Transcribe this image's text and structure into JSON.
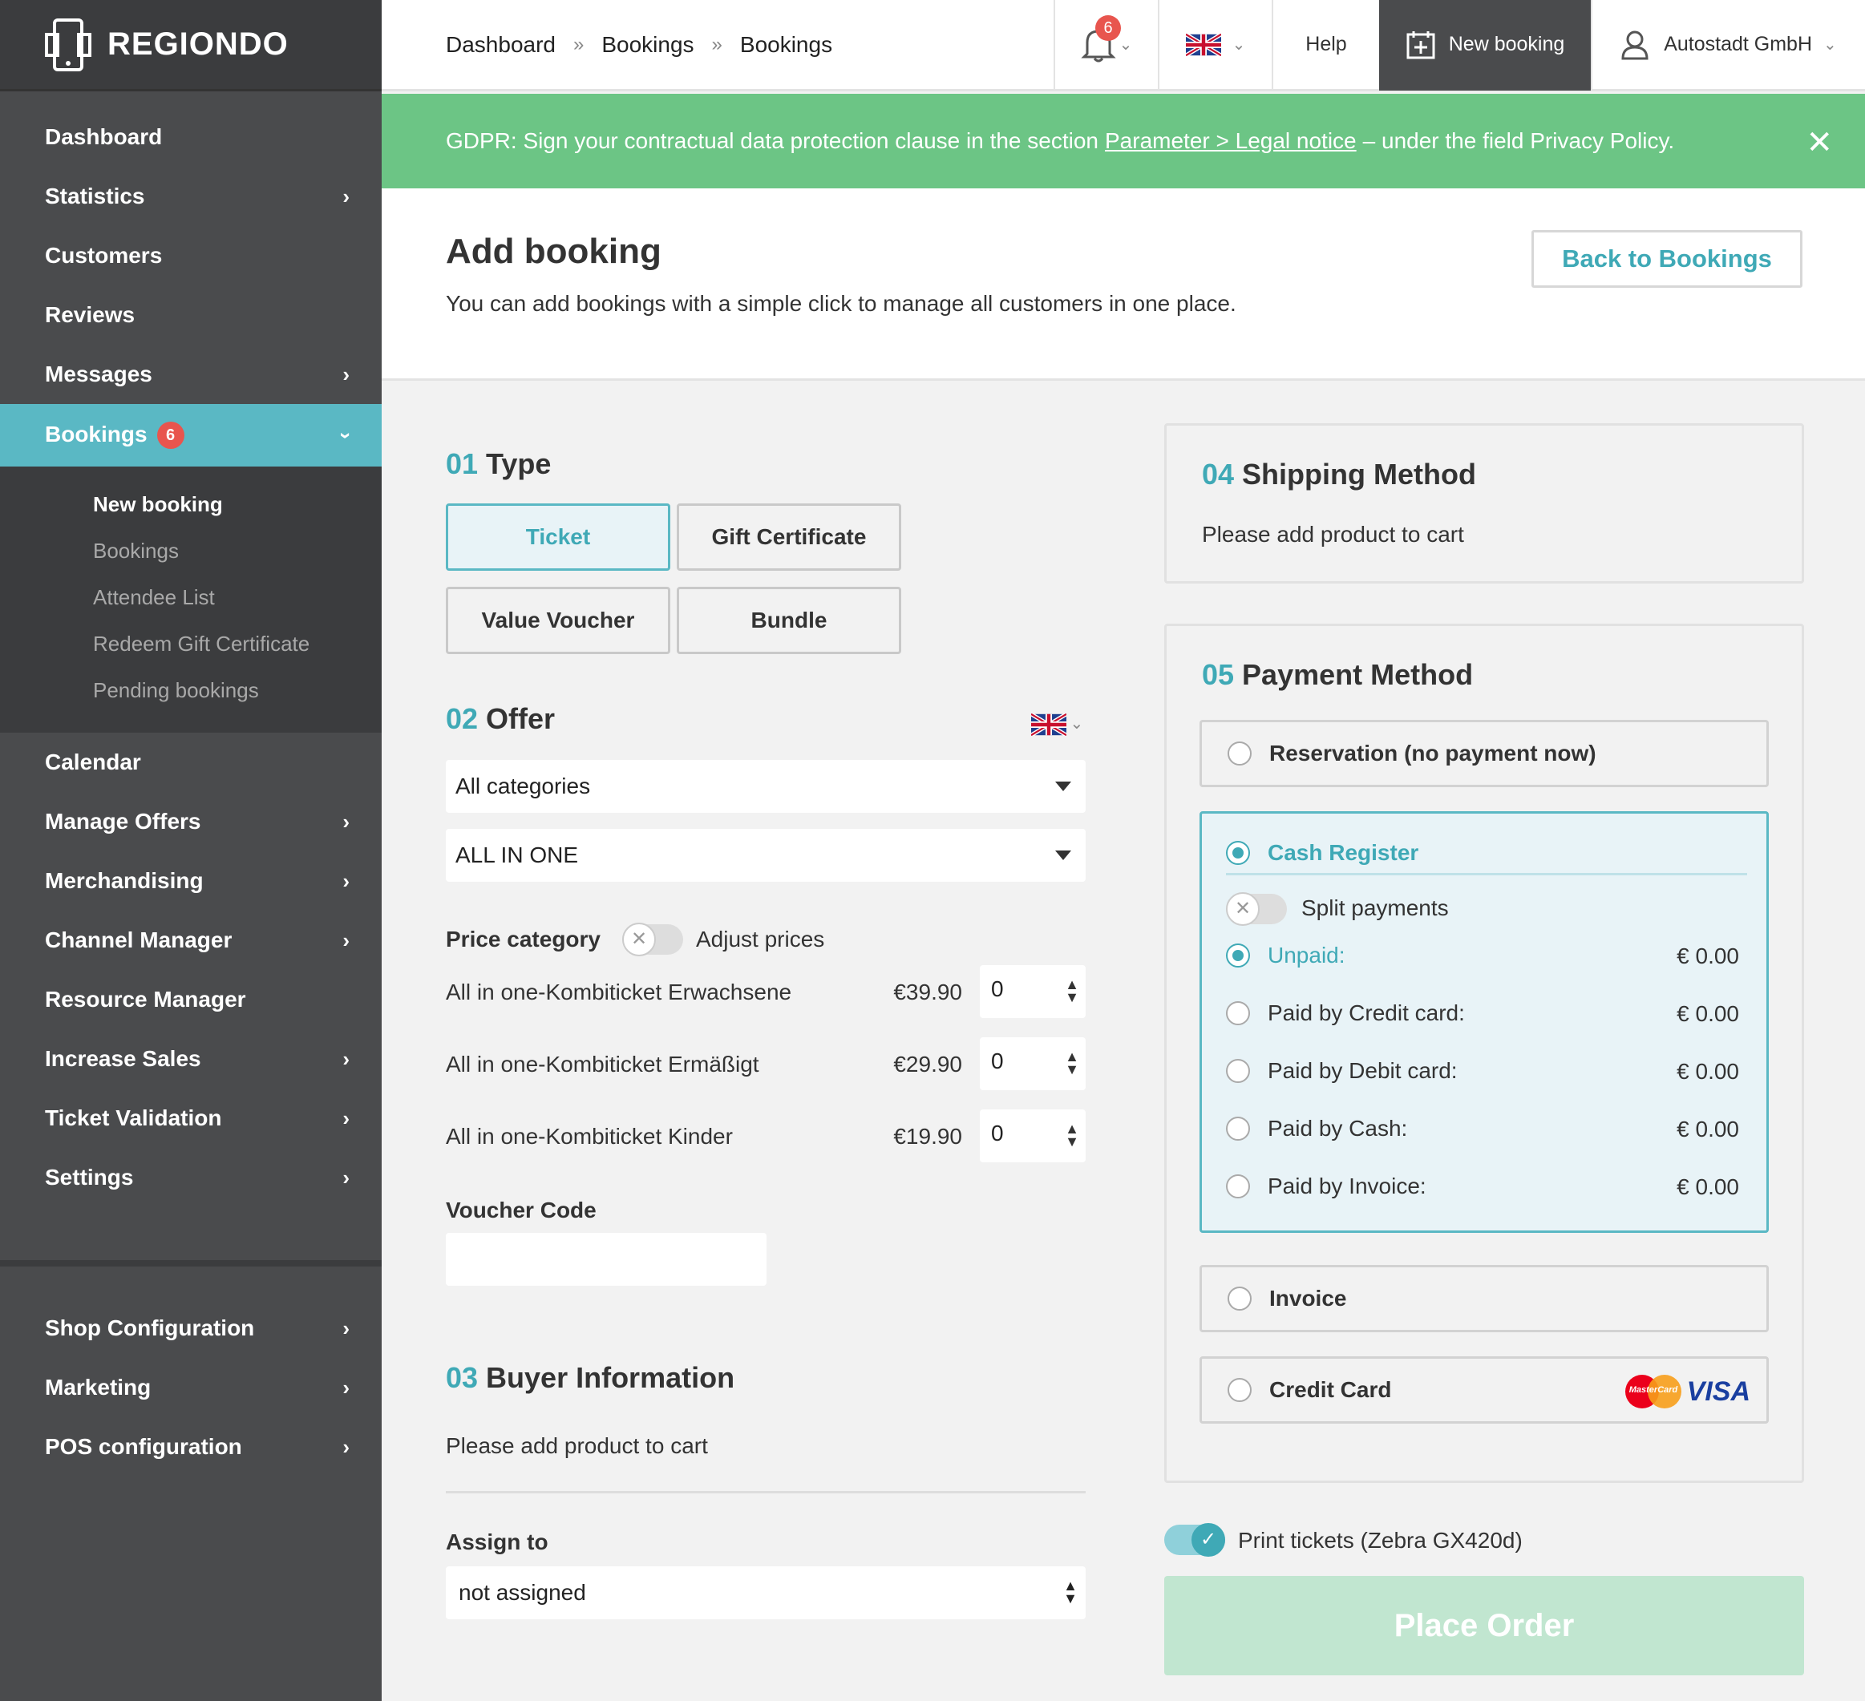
{
  "brand": {
    "name": "REGIONDO"
  },
  "sidebar": {
    "items_top": [
      {
        "label": "Dashboard",
        "chevron": false
      },
      {
        "label": "Statistics",
        "chevron": true
      },
      {
        "label": "Customers",
        "chevron": false
      },
      {
        "label": "Reviews",
        "chevron": false
      },
      {
        "label": "Messages",
        "chevron": true
      }
    ],
    "active": {
      "label": "Bookings",
      "badge": "6"
    },
    "sub": [
      "New booking",
      "Bookings",
      "Attendee List",
      "Redeem Gift Certificate",
      "Pending bookings"
    ],
    "items_mid": [
      {
        "label": "Calendar",
        "chevron": false
      },
      {
        "label": "Manage Offers",
        "chevron": true
      },
      {
        "label": "Merchandising",
        "chevron": true
      },
      {
        "label": "Channel Manager",
        "chevron": true
      },
      {
        "label": "Resource Manager",
        "chevron": false
      },
      {
        "label": "Increase Sales",
        "chevron": true
      },
      {
        "label": "Ticket Validation",
        "chevron": true
      },
      {
        "label": "Settings",
        "chevron": true
      }
    ],
    "items_bottom": [
      {
        "label": "Shop Configuration",
        "chevron": true
      },
      {
        "label": "Marketing",
        "chevron": true
      },
      {
        "label": "POS configuration",
        "chevron": true
      }
    ]
  },
  "topbar": {
    "breadcrumb": [
      "Dashboard",
      "Bookings",
      "Bookings"
    ],
    "breadcrumb_sep": "»",
    "bell_count": "6",
    "help": "Help",
    "new_booking": "New booking",
    "user": "Autostadt GmbH"
  },
  "gdpr": {
    "before": "GDPR: Sign your contractual data protection clause in the section",
    "link": "Parameter > Legal notice",
    "after": "– under the field Privacy Policy."
  },
  "header": {
    "title": "Add booking",
    "subtitle": "You can add bookings with a simple click to manage all customers in one place.",
    "back": "Back to Bookings"
  },
  "type": {
    "num": "01",
    "title": "Type",
    "options": [
      "Ticket",
      "Gift Certificate",
      "Value Voucher",
      "Bundle"
    ],
    "selected": "Ticket"
  },
  "offer": {
    "num": "02",
    "title": "Offer",
    "category": "All categories",
    "product": "ALL IN ONE",
    "price_category_label": "Price category",
    "adjust_prices": "Adjust prices",
    "prices": [
      {
        "name": "All in one-Kombiticket Erwachsene",
        "price": "€39.90",
        "qty": "0"
      },
      {
        "name": "All in one-Kombiticket Ermäßigt",
        "price": "€29.90",
        "qty": "0"
      },
      {
        "name": "All in one-Kombiticket Kinder",
        "price": "€19.90",
        "qty": "0"
      }
    ],
    "voucher_label": "Voucher Code",
    "voucher_value": ""
  },
  "buyer": {
    "num": "03",
    "title": "Buyer Information",
    "text": "Please add product to cart",
    "assign_label": "Assign to",
    "assign_value": "not assigned"
  },
  "shipping": {
    "num": "04",
    "title": "Shipping Method",
    "text": "Please add product to cart"
  },
  "payment": {
    "num": "05",
    "title": "Payment Method",
    "reservation": "Reservation (no payment now)",
    "cash": "Cash Register",
    "split": "Split payments",
    "rows": [
      {
        "label": "Unpaid:",
        "amount": "€ 0.00",
        "selected": true
      },
      {
        "label": "Paid by Credit card:",
        "amount": "€ 0.00",
        "selected": false
      },
      {
        "label": "Paid by Debit card:",
        "amount": "€ 0.00",
        "selected": false
      },
      {
        "label": "Paid by Cash:",
        "amount": "€ 0.00",
        "selected": false
      },
      {
        "label": "Paid by Invoice:",
        "amount": "€ 0.00",
        "selected": false
      }
    ],
    "invoice": "Invoice",
    "credit_card": "Credit Card",
    "mastercard": "MasterCard",
    "visa": "VISA"
  },
  "print": {
    "label": "Print tickets (Zebra GX420d)",
    "enabled": true
  },
  "place_order": "Place Order",
  "colors": {
    "accent": "#5ab8c4",
    "sidebar": "#4a4b4d",
    "gdpr": "#6cc585",
    "badge": "#e8554e"
  }
}
